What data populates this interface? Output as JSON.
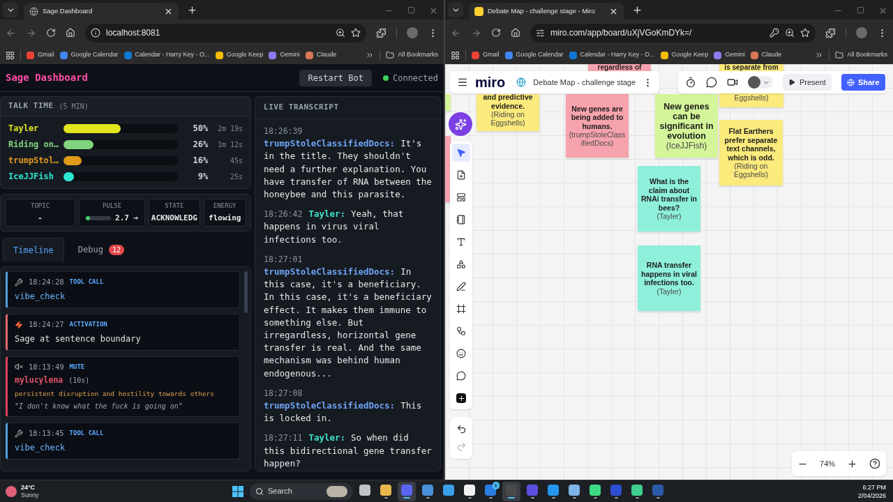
{
  "left_browser": {
    "tab": {
      "kind": "globe",
      "title": "Sage Dashboard"
    },
    "url": "localhost:8081",
    "key_icon": false,
    "bookmarks": [
      {
        "label": "Gmail",
        "color": "#ea4335"
      },
      {
        "label": "Google Calendar",
        "color": "#4285f4"
      },
      {
        "label": "Calendar - Harry Key - O...",
        "color": "#0f78d4"
      },
      {
        "label": "Google Keep",
        "color": "#fbbc04"
      },
      {
        "label": "Gemini",
        "color": "#8e7cf0"
      },
      {
        "label": "Claude",
        "color": "#d97757"
      }
    ],
    "all_bookmarks": "All Bookmarks"
  },
  "dashboard": {
    "title": "Sage Dashboard",
    "restart_button": "Restart Bot",
    "connection": {
      "label": "Connected",
      "connected": true
    },
    "talk_time": {
      "title": "TALK TIME",
      "subtitle": "(5 MIN)",
      "speakers": [
        {
          "name": "Tayler",
          "color": "#e3e61e",
          "level": 0.5,
          "percent": "50%",
          "duration": "2m 19s"
        },
        {
          "name": "Riding on…",
          "color": "#80d47e",
          "level": 0.26,
          "percent": "26%",
          "duration": "1m 12s"
        },
        {
          "name": "trumpStol…",
          "color": "#e09a1a",
          "level": 0.16,
          "percent": "16%",
          "duration": "45s"
        },
        {
          "name": "IceJJFish",
          "color": "#2ee8d2",
          "level": 0.09,
          "percent": "9%",
          "duration": "25s"
        }
      ]
    },
    "stats": [
      {
        "kind": "text",
        "label": "TOPIC",
        "value": "-"
      },
      {
        "kind": "meter",
        "label": "PULSE",
        "value": "2.7 →",
        "level": 0.15
      },
      {
        "kind": "text",
        "label": "STATE",
        "value": "ACKNOWLEDG"
      },
      {
        "kind": "text",
        "label": "ENERGY",
        "value": "flowing"
      }
    ],
    "tabs": [
      {
        "label": "Timeline",
        "selected": true
      },
      {
        "label": "Debug",
        "selected": false,
        "badge": "12"
      }
    ],
    "timeline": [
      {
        "kind": "tool_call",
        "time": "18:24:28",
        "label": "TOOL CALL",
        "text": "vibe_check"
      },
      {
        "kind": "activation",
        "time": "18:24:27",
        "label": "ACTIVATION",
        "text": "Sage at sentence boundary"
      },
      {
        "kind": "mute",
        "time": "18:13:49",
        "label": "MUTE",
        "user": "mylucylena",
        "duration": "(10s)",
        "reason": "persistent disruption and hostility towards others",
        "quote": "\"I don't know what the fuck is going on\""
      },
      {
        "kind": "tool_call",
        "time": "18:13:45",
        "label": "TOOL CALL",
        "text": "vibe_check"
      }
    ],
    "transcript": {
      "title": "LIVE TRANSCRIPT",
      "entries": [
        {
          "time": "18:26:39",
          "speaker": "trumpStoleClassifiedDocs:",
          "color": "#6ea2f2",
          "text": "It's in the title. They shouldn't need a further explanation. You have transfer of RNA between the honeybee and this parasite."
        },
        {
          "time": "18:26:42",
          "speaker": "Tayler:",
          "color": "#3ee3c9",
          "text": "Yeah, that happens in virus viral infections too."
        },
        {
          "time": "18:27:01",
          "speaker": "trumpStoleClassifiedDocs:",
          "color": "#6ea2f2",
          "text": "In this case, it's a beneficiary. In this case, it's a beneficiary effect. It makes them immune to something else. But irregardless, horizontal gene transfer is real. And the same mechanism was behind human endogenous..."
        },
        {
          "time": "18:27:08",
          "speaker": "trumpStoleClassifiedDocs:",
          "color": "#6ea2f2",
          "text": "This is locked in."
        },
        {
          "time": "18:27:11",
          "speaker": "Tayler:",
          "color": "#3ee3c9",
          "text": "So when did this bidirectional gene transfer happen?"
        }
      ]
    }
  },
  "right_browser": {
    "tab": {
      "kind": "miro",
      "title": "Debate Map - challenge stage - Miro"
    },
    "url": "miro.com/app/board/uXjVGoKmDYk=/",
    "key_icon": true,
    "bookmarks": [
      {
        "label": "Gmail",
        "color": "#ea4335"
      },
      {
        "label": "Google Calendar",
        "color": "#4285f4"
      },
      {
        "label": "Calendar - Harry Key - O...",
        "color": "#0f78d4"
      },
      {
        "label": "Google Keep",
        "color": "#fbbc04"
      },
      {
        "label": "Gemini",
        "color": "#8e7cf0"
      },
      {
        "label": "Claude",
        "color": "#d97757"
      }
    ],
    "all_bookmarks": "All Bookmarks"
  },
  "miro": {
    "logo": "miro",
    "board_title": "Debate Map - challenge stage",
    "present_button": "Present",
    "share_button": "Share",
    "zoom": "74%",
    "stickies": [
      {
        "color": "#d4f59a"
      },
      {
        "color": "#fbea7c",
        "text": "and predictive evidence.",
        "author": "(Riding on Eggshells)"
      },
      {
        "color": "#f6a3ad",
        "text": "regardless of"
      },
      {
        "color": "#f6a3ad",
        "text": "New genes are being added to humans.",
        "author": "(trumpStoleClassifiedDocs)"
      },
      {
        "color": "#d4f59a",
        "text": "New genes can be significant in evolution",
        "author": "(IceJJFish)"
      },
      {
        "color": "#fbea7c",
        "text": "is separate from",
        "author": "Eggshells)"
      },
      {
        "color": "#fbea7c",
        "text": "Flat Earthers prefer separate text channels, which is odd.",
        "author": "(Riding on Eggshells)"
      },
      {
        "color": "#f6a3ad"
      },
      {
        "color": "#8ef0da",
        "text": "What is the claim about RNAi transfer in bees?",
        "author": "(Tayler)"
      },
      {
        "color": "#8ef0da",
        "text": "RNA transfer happens in viral infections too.",
        "author": "(Tayler)"
      }
    ],
    "tools": [
      {
        "kind": "select",
        "selected": true
      },
      {
        "kind": "note_add",
        "selected": false
      },
      {
        "kind": "template",
        "selected": false
      },
      {
        "kind": "sticky",
        "selected": false
      },
      {
        "kind": "text",
        "selected": false
      },
      {
        "kind": "shapes",
        "selected": false
      },
      {
        "kind": "pen",
        "selected": false
      },
      {
        "kind": "frame",
        "selected": false
      },
      {
        "kind": "diagram",
        "selected": false
      },
      {
        "kind": "sticker",
        "selected": false
      },
      {
        "kind": "comment",
        "selected": false
      },
      {
        "kind": "more",
        "selected": false
      }
    ]
  },
  "taskbar": {
    "temperature": "24°C",
    "weather": "Sunny",
    "search": "Search",
    "time": "6:27 PM",
    "date": "2/04/2026",
    "apps": [
      {
        "color": "#bfc4c9",
        "open": false,
        "selected": false
      },
      {
        "color": "#e8b84a",
        "open": true,
        "selected": false
      },
      {
        "color": "#5865f2",
        "open": true,
        "selected": true
      },
      {
        "color": "#4a90d9",
        "open": true,
        "selected": false
      },
      {
        "color": "#3aa0e8",
        "open": false,
        "selected": false
      },
      {
        "color": "#f0f0f0",
        "open": true,
        "selected": false
      },
      {
        "color": "#2a7de1",
        "open": true,
        "selected": false,
        "badge": "6"
      },
      {
        "color": "#4a4a4a",
        "open": true,
        "selected": true
      },
      {
        "color": "#5b4fe0",
        "open": true,
        "selected": false
      },
      {
        "color": "#2496ed",
        "open": true,
        "selected": false
      },
      {
        "color": "#7fb4e8",
        "open": true,
        "selected": false
      },
      {
        "color": "#3ddc84",
        "open": true,
        "selected": false
      },
      {
        "color": "#2f4fd0",
        "open": true,
        "selected": false
      },
      {
        "color": "#3ecf8e",
        "open": true,
        "selected": false
      },
      {
        "color": "#2a5aa8",
        "open": true,
        "selected": false
      }
    ]
  }
}
